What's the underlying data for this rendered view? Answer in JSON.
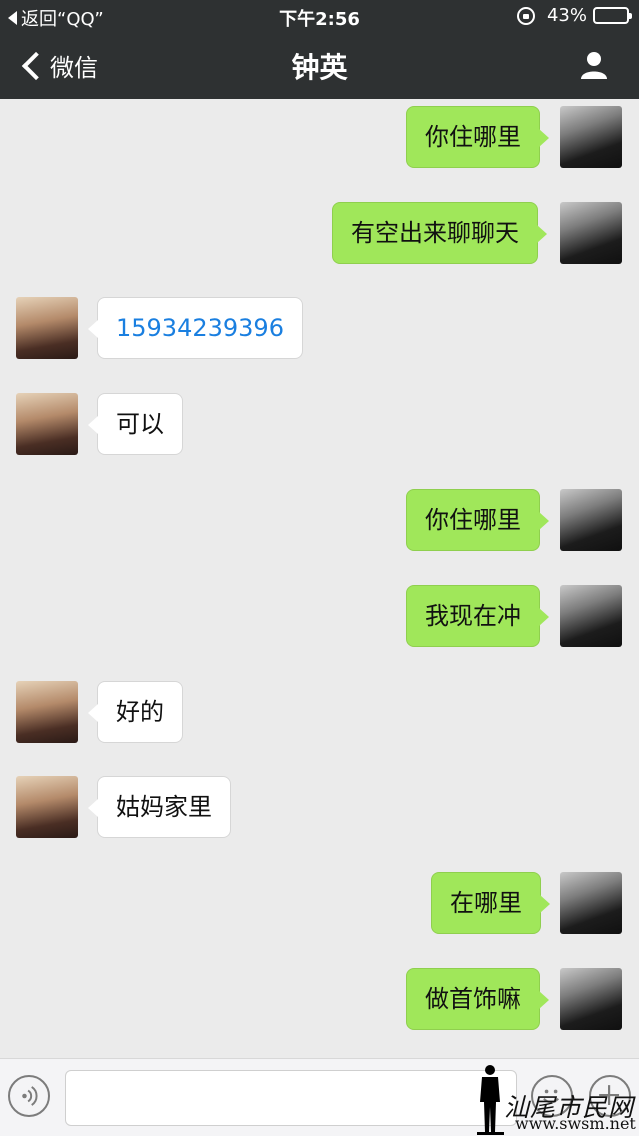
{
  "status_bar": {
    "back_app": "返回“QQ”",
    "time": "下午2:56",
    "battery": "43%",
    "battery_level": 0.43
  },
  "nav": {
    "back_label": "微信",
    "title": "钟英",
    "profile_icon": "person-icon"
  },
  "messages": [
    {
      "from": "me",
      "text": "你住哪里"
    },
    {
      "from": "me",
      "text": "有空出来聊聊天"
    },
    {
      "from": "her",
      "text": "15934239396"
    },
    {
      "from": "her",
      "text": "可以"
    },
    {
      "from": "me",
      "text": "你住哪里"
    },
    {
      "from": "me",
      "text": "我现在冲"
    },
    {
      "from": "her",
      "text": "好的"
    },
    {
      "from": "her",
      "text": "姑妈家里"
    },
    {
      "from": "me",
      "text": "在哪里"
    },
    {
      "from": "me",
      "text": "做首饰嘛"
    }
  ],
  "input_bar": {
    "voice_icon": "voice-icon",
    "emoji_icon": "emoji-icon",
    "plus_icon": "plus-icon"
  },
  "watermark": {
    "text": "汕尾市民网",
    "url": "www.swsm.net"
  },
  "colors": {
    "nav_bg": "#2e3132",
    "bubble_me": "#a0e75a",
    "bubble_her": "#ffffff",
    "link": "#1a7fe0",
    "chat_bg": "#ebebeb"
  }
}
